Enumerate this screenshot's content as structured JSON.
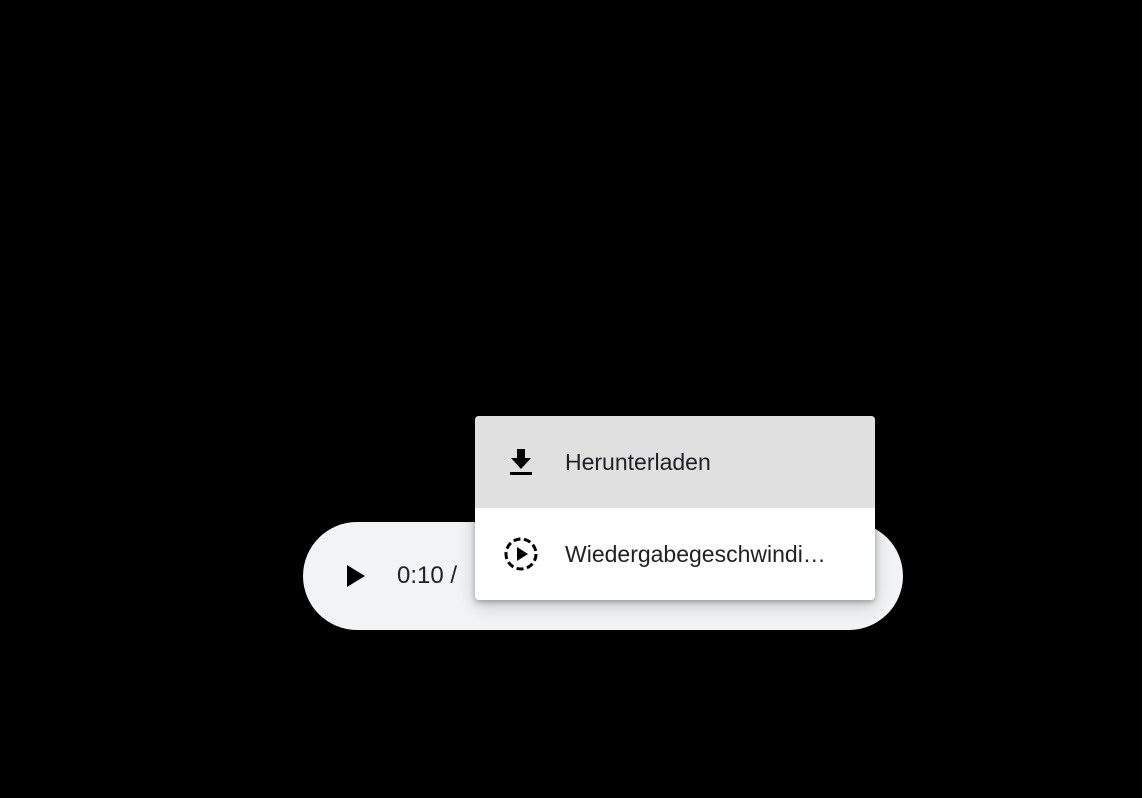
{
  "player": {
    "time_display": "0:10 /",
    "play_icon": "play-icon"
  },
  "menu": {
    "items": [
      {
        "label": "Herunterladen",
        "icon": "download-icon",
        "highlighted": true
      },
      {
        "label": "Wiedergabegeschwindi…",
        "icon": "playback-speed-icon",
        "highlighted": false
      }
    ]
  },
  "colors": {
    "background": "#000000",
    "player_bg": "#f1f3f4",
    "menu_bg": "#ffffff",
    "highlight_bg": "#e0e0e0",
    "text": "#202124"
  }
}
